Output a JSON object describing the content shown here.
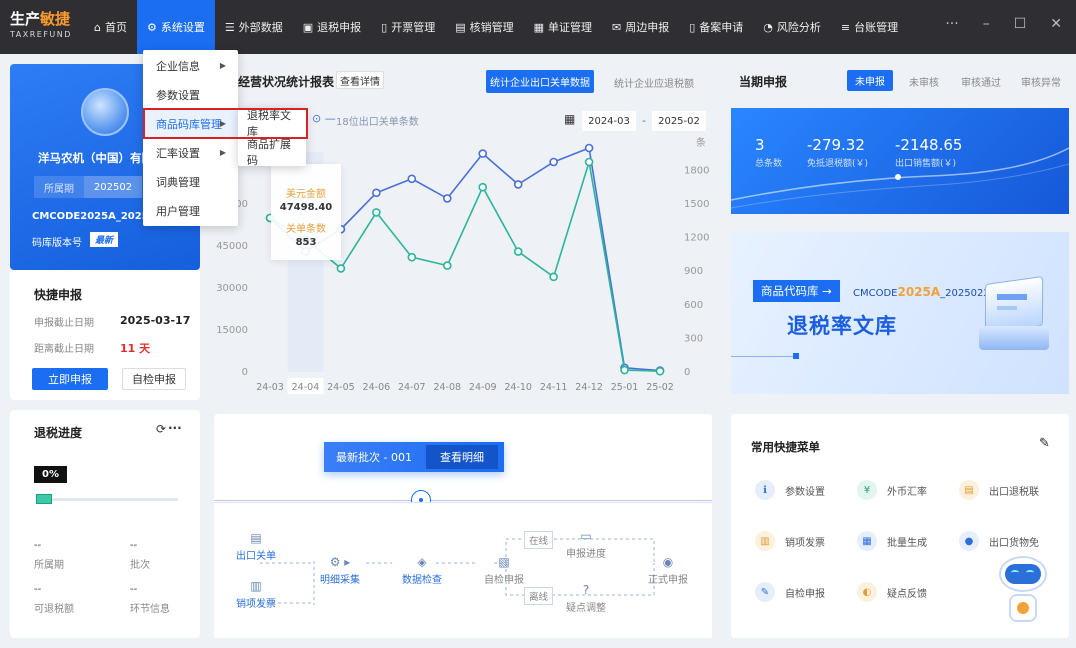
{
  "app": {
    "logo_main": "生产",
    "logo_accent": "敏捷",
    "logo_sub": "TAXREFUND"
  },
  "nav": [
    {
      "label": "首页",
      "icon": "⌂"
    },
    {
      "label": "系统设置",
      "icon": "⚙"
    },
    {
      "label": "外部数据",
      "icon": "☰"
    },
    {
      "label": "退税申报",
      "icon": "▣"
    },
    {
      "label": "开票管理",
      "icon": "▯"
    },
    {
      "label": "核销管理",
      "icon": "▤"
    },
    {
      "label": "单证管理",
      "icon": "▦"
    },
    {
      "label": "周边申报",
      "icon": "✉"
    },
    {
      "label": "备案申请",
      "icon": "▯"
    },
    {
      "label": "风险分析",
      "icon": "◔"
    },
    {
      "label": "台账管理",
      "icon": "≡"
    }
  ],
  "window": {
    "more": "···",
    "minimize": "–",
    "maximize": "☐",
    "close": "✕"
  },
  "menu": {
    "level1": [
      "企业信息",
      "参数设置",
      "商品码库管理",
      "汇率设置",
      "词典管理",
      "用户管理"
    ],
    "level2": [
      "退税率文库",
      "商品扩展码"
    ]
  },
  "company": {
    "name": "洋马农机（中国）有限",
    "period_label": "所属期",
    "period": "202502",
    "code": "CMCODE2025A_20250226",
    "version_label": "码库版本号",
    "version_badge": "最新"
  },
  "quick": {
    "title": "快捷申报",
    "deadline_label": "申报截止日期",
    "deadline": "2025-03-17",
    "remain_label": "距离截止日期",
    "remain": "11 天",
    "btn_declare": "立即申报",
    "btn_self": "自检申报"
  },
  "progress": {
    "title": "退税进度",
    "more": "···",
    "pct": "0%",
    "value": 0,
    "stats": [
      {
        "value": "--",
        "label": "所属期"
      },
      {
        "value": "--",
        "label": "批次"
      },
      {
        "value": "--",
        "label": "可退税额"
      },
      {
        "value": "--",
        "label": "环节信息"
      }
    ]
  },
  "chart_card": {
    "title": "经营状况统计报表",
    "detail_btn": "查看详情",
    "tab_active": "统计企业出口关单数据",
    "tab_other": "统计企业应退税额",
    "date_from": "2024-03",
    "date_to": "2025-02",
    "date_sep": "-",
    "legend_partial": "18位出口关单条数",
    "right_unit": "条"
  },
  "tooltip": {
    "usd_label": "美元金额",
    "usd_value": "47498.40",
    "count_label": "关单条数",
    "count_value": "853"
  },
  "chart_data": {
    "type": "line",
    "x": [
      "24-03",
      "24-04",
      "24-05",
      "24-06",
      "24-07",
      "24-08",
      "24-09",
      "24-10",
      "24-11",
      "24-12",
      "25-01",
      "25-02"
    ],
    "highlight": "24-04",
    "y_left_ticks": [
      0,
      15000,
      30000,
      45000,
      60000
    ],
    "y_right_ticks": [
      0,
      300,
      600,
      900,
      1200,
      1500,
      1800
    ],
    "ylim_left": [
      0,
      75000
    ],
    "ylim_right": [
      0,
      1875
    ],
    "series": [
      {
        "name": "",
        "axis": "left",
        "color": "#4a6fd8",
        "values": [
          55000,
          43000,
          51000,
          64000,
          69000,
          62000,
          78000,
          67000,
          75000,
          80000,
          1500,
          500
        ]
      },
      {
        "name": "",
        "axis": "left",
        "color": "#2bb59a",
        "values": [
          55000,
          47498,
          37000,
          57000,
          41000,
          38000,
          66000,
          43000,
          34000,
          75000,
          700,
          300
        ]
      }
    ]
  },
  "period_card": {
    "title": "当期申报",
    "tabs": [
      "未申报",
      "未审核",
      "审核通过",
      "审核异常"
    ],
    "stats": [
      {
        "value": "3",
        "label": "总条数"
      },
      {
        "value": "-279.32",
        "label": "免抵退税额(￥)"
      },
      {
        "value": "-2148.65",
        "label": "出口销售额(￥)"
      }
    ]
  },
  "banner": {
    "tag": "商品代码库",
    "arrow": "→",
    "code_pre": "CMCODE",
    "code_year": "2025A",
    "code_post": "_20250226",
    "title": "退税率文库"
  },
  "batch": {
    "label": "最新批次 - 001",
    "btn": "查看明细"
  },
  "flow": {
    "export_doc": "出口关单",
    "invoice": "销项发票",
    "collect": "明细采集",
    "check": "数据检查",
    "self_check": "自检申报",
    "online": "在线",
    "offline": "离线",
    "progress": "申报进度",
    "doubt": "疑点调整",
    "formal": "正式申报"
  },
  "shortcuts": {
    "title": "常用快捷菜单",
    "edit": "✎",
    "items": [
      {
        "label": "参数设置",
        "icon": "ℹ",
        "color": "#2b6fd8",
        "bg": "#e6eefc"
      },
      {
        "label": "外币汇率",
        "icon": "¥",
        "color": "#1ea37a",
        "bg": "#e2f5ee"
      },
      {
        "label": "出口退税联",
        "icon": "▤",
        "color": "#e69a2a",
        "bg": "#fcf1df"
      },
      {
        "label": "销项发票",
        "icon": "▥",
        "color": "#e69a2a",
        "bg": "#fcf1df"
      },
      {
        "label": "批量生成",
        "icon": "▦",
        "color": "#2b6fd8",
        "bg": "#e6eefc"
      },
      {
        "label": "出口货物免",
        "icon": "●",
        "color": "#2b6fd8",
        "bg": "#e6eefc"
      },
      {
        "label": "自检申报",
        "icon": "✎",
        "color": "#2b6fd8",
        "bg": "#e6eefc"
      },
      {
        "label": "疑点反馈",
        "icon": "◐",
        "color": "#e69a2a",
        "bg": "#fcf1df"
      }
    ]
  }
}
